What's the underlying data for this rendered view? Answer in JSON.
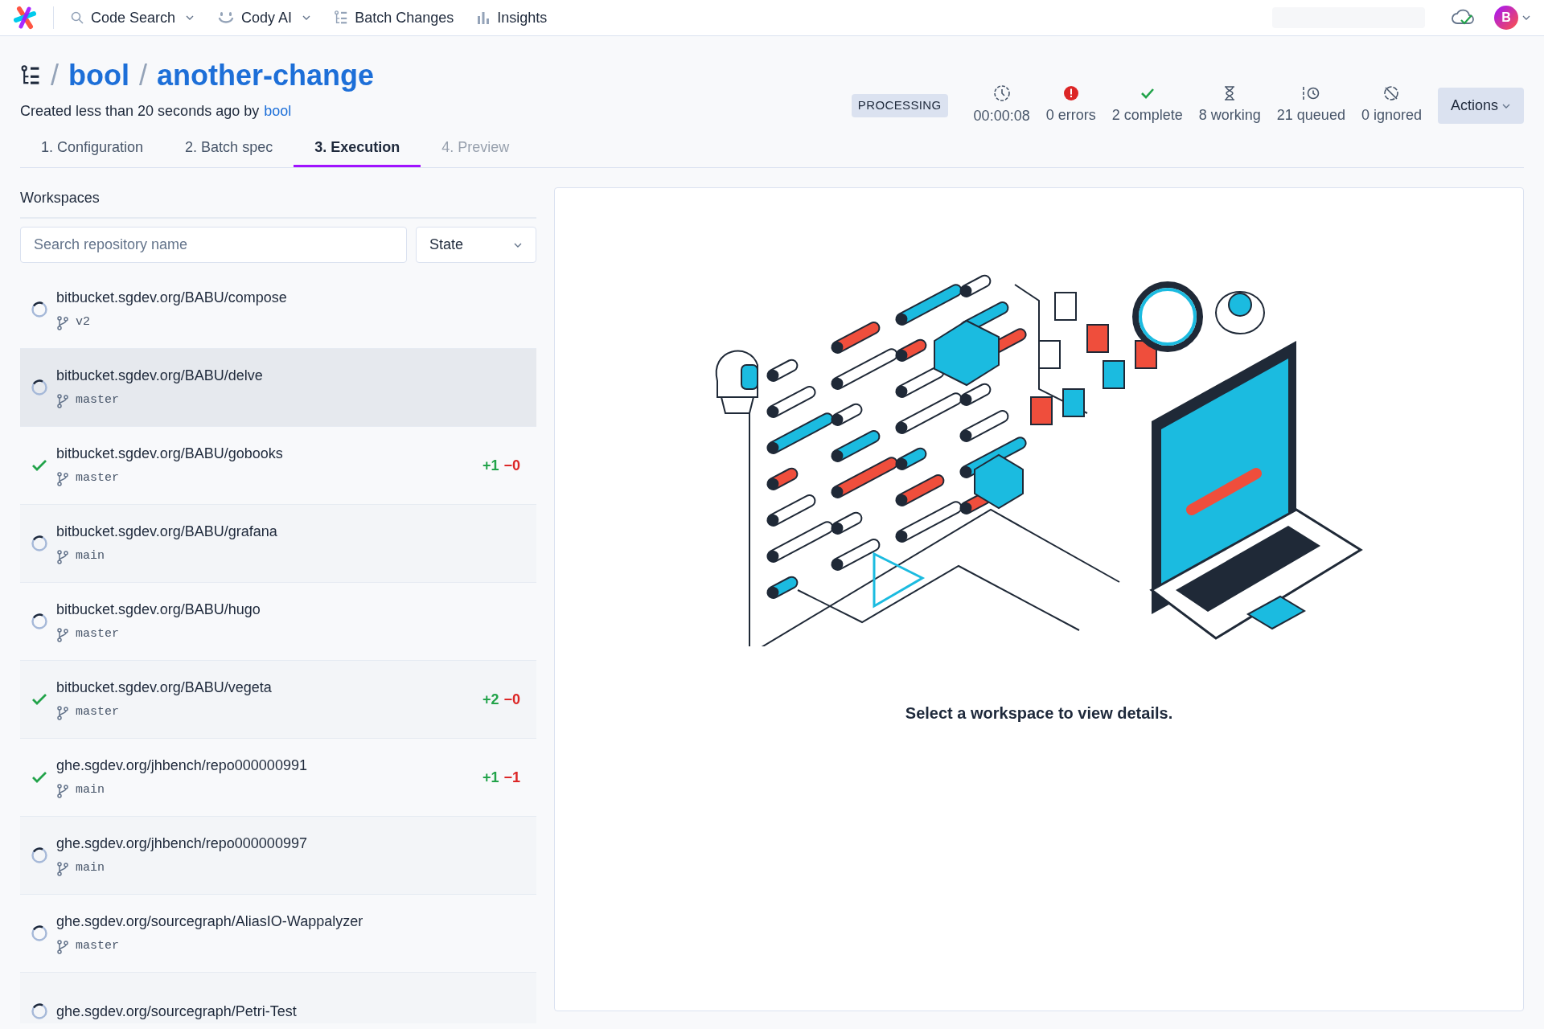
{
  "nav": {
    "items": [
      {
        "label": "Code Search",
        "dropdown": true
      },
      {
        "label": "Cody AI",
        "dropdown": true
      },
      {
        "label": "Batch Changes",
        "dropdown": false
      },
      {
        "label": "Insights",
        "dropdown": false
      }
    ],
    "avatar": "B"
  },
  "header": {
    "separators": [
      "/",
      "/"
    ],
    "namespace": "bool",
    "name": "another-change",
    "created": "Created less than 20 seconds ago by",
    "author": "bool"
  },
  "status": {
    "badge": "PROCESSING",
    "stats": [
      {
        "kind": "time",
        "label": "00:00:08"
      },
      {
        "kind": "errors",
        "label": "0 errors"
      },
      {
        "kind": "complete",
        "label": "2 complete"
      },
      {
        "kind": "working",
        "label": "8 working"
      },
      {
        "kind": "queued",
        "label": "21 queued"
      },
      {
        "kind": "ignored",
        "label": "0 ignored"
      }
    ],
    "actions": "Actions"
  },
  "tabs": [
    {
      "label": "1. Configuration",
      "selected": false,
      "disabled": false
    },
    {
      "label": "2. Batch spec",
      "selected": false,
      "disabled": false
    },
    {
      "label": "3. Execution",
      "selected": true,
      "disabled": false
    },
    {
      "label": "4. Preview",
      "selected": false,
      "disabled": true
    }
  ],
  "workspaces": {
    "title": "Workspaces",
    "search": {
      "placeholder": "Search repository name"
    },
    "state_filter": "State",
    "rows": [
      {
        "repo": "bitbucket.sgdev.org/BABU/compose",
        "branch": "v2",
        "kind": "processing",
        "highlighted": false
      },
      {
        "repo": "bitbucket.sgdev.org/BABU/delve",
        "branch": "master",
        "kind": "processing",
        "highlighted": true
      },
      {
        "repo": "bitbucket.sgdev.org/BABU/gobooks",
        "branch": "master",
        "kind": "completed",
        "highlighted": false,
        "added": "+1",
        "deleted": "−0"
      },
      {
        "repo": "bitbucket.sgdev.org/BABU/grafana",
        "branch": "main",
        "kind": "processing",
        "highlighted": false
      },
      {
        "repo": "bitbucket.sgdev.org/BABU/hugo",
        "branch": "master",
        "kind": "processing",
        "highlighted": false
      },
      {
        "repo": "bitbucket.sgdev.org/BABU/vegeta",
        "branch": "master",
        "kind": "completed",
        "highlighted": false,
        "added": "+2",
        "deleted": "−0"
      },
      {
        "repo": "ghe.sgdev.org/jhbench/repo000000991",
        "branch": "main",
        "kind": "completed",
        "highlighted": false,
        "added": "+1",
        "deleted": "−1"
      },
      {
        "repo": "ghe.sgdev.org/jhbench/repo000000997",
        "branch": "main",
        "kind": "processing",
        "highlighted": false
      },
      {
        "repo": "ghe.sgdev.org/sourcegraph/AliasIO-Wappalyzer",
        "branch": "master",
        "kind": "processing",
        "highlighted": false
      },
      {
        "repo": "ghe.sgdev.org/sourcegraph/Petri-Test",
        "kind": "processing",
        "highlighted": false
      }
    ]
  },
  "details": {
    "message": "Select a workspace to view details."
  }
}
